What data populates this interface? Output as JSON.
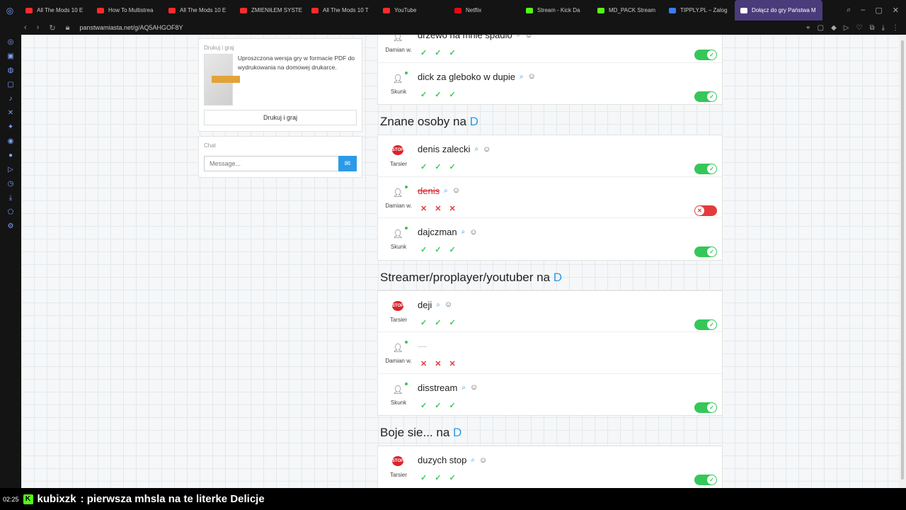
{
  "browser": {
    "tabs": [
      {
        "label": "All The Mods 10 E",
        "color": "#ff2a2a"
      },
      {
        "label": "How To Multistrea",
        "color": "#ff2a2a"
      },
      {
        "label": "All The Mods 10 E",
        "color": "#ff2a2a"
      },
      {
        "label": "ZMIENIŁEM SYSTE",
        "color": "#ff2a2a"
      },
      {
        "label": "All The Mods 10 T",
        "color": "#ff2a2a"
      },
      {
        "label": "YouTube",
        "color": "#ff2a2a"
      },
      {
        "label": "Netflix",
        "color": "#e50914"
      },
      {
        "label": "Stream - Kick Da",
        "color": "#53fc18"
      },
      {
        "label": "MD_PACK Stream",
        "color": "#53fc18"
      },
      {
        "label": "TIPPLY.PL – Zalog",
        "color": "#3b7bff"
      },
      {
        "label": "Dołącz do gry Państwa M",
        "color": "#ffffff",
        "active": true
      }
    ],
    "url": "panstwamiasta.net/g/AQ5AHGOF8Y"
  },
  "left": {
    "print_card": {
      "title": "Drukuj i graj",
      "description": "Uproszczona wersja gry w formacie PDF do wydrukowania na domowej drukarce.",
      "button": "Drukuj i graj"
    },
    "chat": {
      "title": "Chat",
      "placeholder": "Message..."
    }
  },
  "categories": [
    {
      "title": "",
      "letter": "",
      "answers": [
        {
          "player": "Damian w.",
          "word": "drzewo na mnie spadlo",
          "avatar": "person",
          "status": "accepted"
        },
        {
          "player": "Skunk",
          "word": "dick za gleboko w dupie",
          "avatar": "person",
          "status": "accepted"
        }
      ]
    },
    {
      "title": "Znane osoby na",
      "letter": "D",
      "answers": [
        {
          "player": "Tarsier",
          "word": "denis zalecki",
          "avatar": "stop",
          "status": "accepted"
        },
        {
          "player": "Damian w.",
          "word": "denis",
          "avatar": "person",
          "status": "rejected"
        },
        {
          "player": "Skunk",
          "word": "dajczman",
          "avatar": "person",
          "status": "accepted"
        }
      ]
    },
    {
      "title": "Streamer/proplayer/youtuber na",
      "letter": "D",
      "answers": [
        {
          "player": "Tarsier",
          "word": "deji",
          "avatar": "stop",
          "status": "accepted"
        },
        {
          "player": "Damian w.",
          "word": "—",
          "avatar": "person",
          "status": "empty"
        },
        {
          "player": "Skunk",
          "word": "disstream",
          "avatar": "person",
          "status": "accepted"
        }
      ]
    },
    {
      "title": "Boje sie... na",
      "letter": "D",
      "answers": [
        {
          "player": "Tarsier",
          "word": "duzych stop",
          "avatar": "stop",
          "status": "accepted"
        }
      ]
    }
  ],
  "stream_overlay": {
    "time": "02:25",
    "user": "kubixzk",
    "message": ": pierwsza mhsla na te literke Delicje"
  },
  "colors": {
    "accent": "#2b9be8",
    "accepted": "#35c759",
    "rejected": "#e23b3b",
    "kick": "#53fc18"
  }
}
